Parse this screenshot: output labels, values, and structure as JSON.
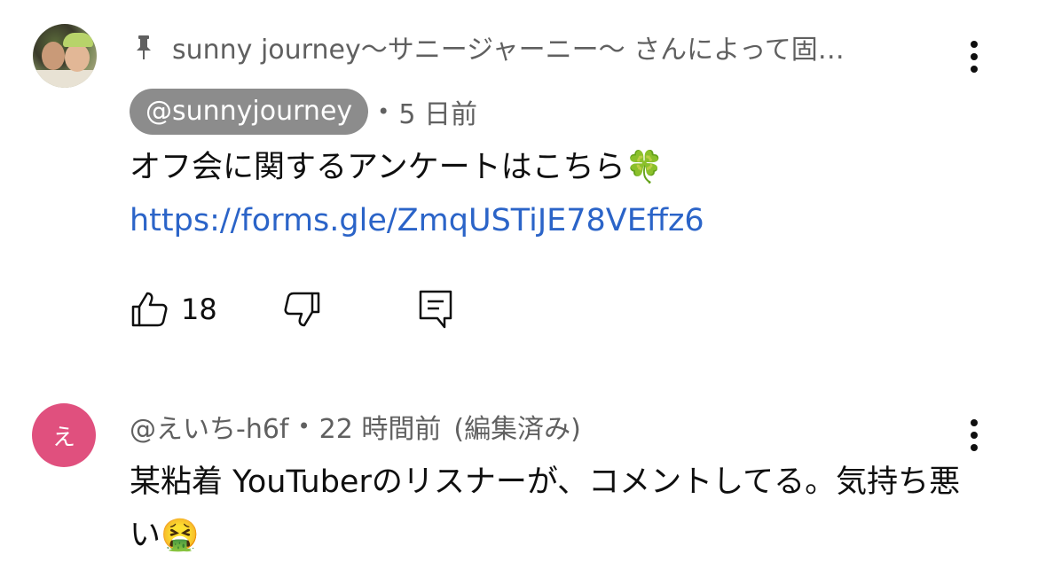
{
  "pinned_comment": {
    "pin_text": "sunny journey〜サニージャーニー〜 さんによって固…",
    "author": "@sunnyjourney",
    "time": "5 日前",
    "text": "オフ会に関するアンケートはこちら🍀",
    "link": "https://forms.gle/ZmqUSTiJE78VEffz6",
    "like_count": "18"
  },
  "reply_comment": {
    "avatar_letter": "え",
    "author": "@えいち-h6f",
    "time": "22 時間前",
    "edited": "(編集済み)",
    "text": "某粘着 YouTuberのリスナーが、コメントしてる。気持ち悪い🤮"
  },
  "icons": {
    "pin": "pin-icon",
    "more": "more-vertical-icon",
    "like": "thumbs-up-icon",
    "dislike": "thumbs-down-icon",
    "reply": "reply-comment-icon"
  },
  "colors": {
    "author_chip_bg": "#8c8c8c",
    "link": "#2b64c8",
    "secondary_text": "#606060",
    "reply_avatar_bg": "#e0507e"
  }
}
